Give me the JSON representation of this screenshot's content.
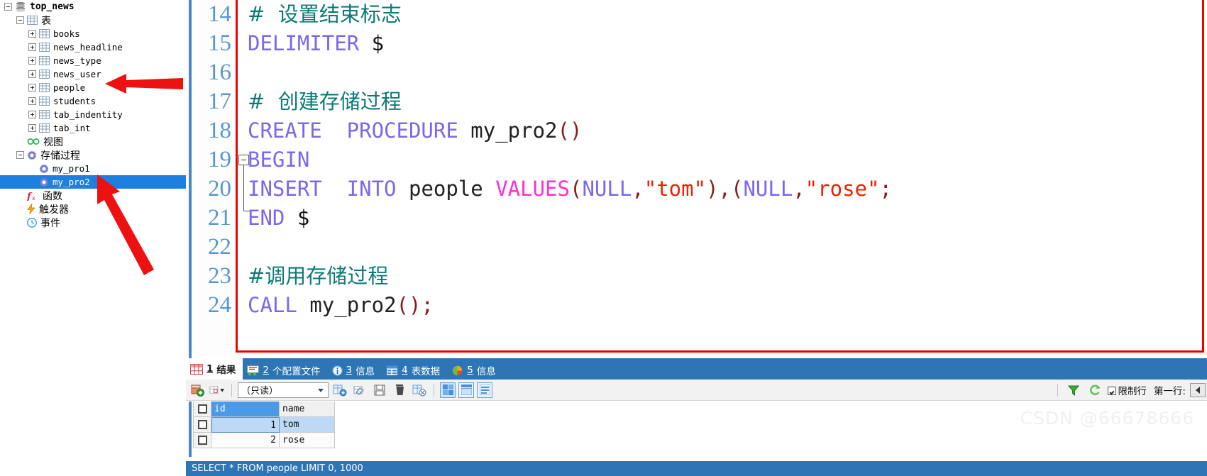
{
  "sidebar": {
    "nodes": [
      {
        "label": "top_news",
        "kind": "database",
        "indent": 0,
        "expander": "minus",
        "icon": "database-icon",
        "font": "mono-bold"
      },
      {
        "label": "表",
        "kind": "folder",
        "indent": 1,
        "expander": "minus",
        "icon": "table-group-icon",
        "font": "cjk"
      },
      {
        "label": "books",
        "kind": "table",
        "indent": 2,
        "expander": "plus",
        "icon": "table-icon",
        "font": "mono"
      },
      {
        "label": "news_headline",
        "kind": "table",
        "indent": 2,
        "expander": "plus",
        "icon": "table-icon",
        "font": "mono"
      },
      {
        "label": "news_type",
        "kind": "table",
        "indent": 2,
        "expander": "plus",
        "icon": "table-icon",
        "font": "mono"
      },
      {
        "label": "news_user",
        "kind": "table",
        "indent": 2,
        "expander": "plus",
        "icon": "table-icon",
        "font": "mono"
      },
      {
        "label": "people",
        "kind": "table",
        "indent": 2,
        "expander": "plus",
        "icon": "table-icon",
        "font": "mono"
      },
      {
        "label": "students",
        "kind": "table",
        "indent": 2,
        "expander": "plus",
        "icon": "table-icon",
        "font": "mono"
      },
      {
        "label": "tab_indentity",
        "kind": "table",
        "indent": 2,
        "expander": "plus",
        "icon": "table-icon",
        "font": "mono"
      },
      {
        "label": "tab_int",
        "kind": "table",
        "indent": 2,
        "expander": "plus",
        "icon": "table-icon",
        "font": "mono"
      },
      {
        "label": "视图",
        "kind": "folder",
        "indent": 1,
        "expander": "none",
        "icon": "view-glasses-icon",
        "font": "cjk"
      },
      {
        "label": "存储过程",
        "kind": "folder",
        "indent": 1,
        "expander": "minus",
        "icon": "gear-icon",
        "font": "cjk"
      },
      {
        "label": "my_pro1",
        "kind": "procedure",
        "indent": 2,
        "expander": "none",
        "icon": "gear-icon",
        "font": "mono"
      },
      {
        "label": "my_pro2",
        "kind": "procedure",
        "indent": 2,
        "expander": "none",
        "icon": "gear-icon",
        "font": "mono",
        "selected": true
      },
      {
        "label": "函数",
        "kind": "folder",
        "indent": 1,
        "expander": "none",
        "icon": "function-fx-icon",
        "font": "cjk"
      },
      {
        "label": "触发器",
        "kind": "folder",
        "indent": 1,
        "expander": "none",
        "icon": "lightning-icon",
        "font": "cjk"
      },
      {
        "label": "事件",
        "kind": "folder",
        "indent": 1,
        "expander": "none",
        "icon": "clock-icon",
        "font": "cjk"
      }
    ]
  },
  "editor": {
    "line_numbers": [
      "14",
      "15",
      "16",
      "17",
      "18",
      "19",
      "20",
      "21",
      "22",
      "23",
      "24"
    ],
    "lines": [
      {
        "no": "14",
        "tokens": [
          {
            "t": "#  设置结束标志",
            "c": "cmt",
            "cjk": true
          }
        ]
      },
      {
        "no": "15",
        "tokens": [
          {
            "t": "DELIMITER ",
            "c": "kw"
          },
          {
            "t": "$",
            "c": "dollar"
          }
        ]
      },
      {
        "no": "16",
        "tokens": []
      },
      {
        "no": "17",
        "tokens": [
          {
            "t": "#  创建存储过程",
            "c": "cmt",
            "cjk": true
          }
        ]
      },
      {
        "no": "18",
        "tokens": [
          {
            "t": "CREATE  PROCEDURE ",
            "c": "kw"
          },
          {
            "t": "my_pro2",
            "c": "pln"
          },
          {
            "t": "()",
            "c": "par"
          }
        ]
      },
      {
        "no": "19",
        "tokens": [
          {
            "t": "BEGIN",
            "c": "kw"
          }
        ]
      },
      {
        "no": "20",
        "tokens": [
          {
            "t": "INSERT  INTO ",
            "c": "kw"
          },
          {
            "t": "people ",
            "c": "pln"
          },
          {
            "t": "VALUES",
            "c": "mag"
          },
          {
            "t": "(",
            "c": "par"
          },
          {
            "t": "NULL",
            "c": "kw"
          },
          {
            "t": ",",
            "c": "par"
          },
          {
            "t": "\"tom\"",
            "c": "str"
          },
          {
            "t": "),(",
            "c": "par"
          },
          {
            "t": "NULL",
            "c": "kw"
          },
          {
            "t": ",",
            "c": "par"
          },
          {
            "t": "\"rose\"",
            "c": "str"
          },
          {
            "t": ";",
            "c": "par"
          }
        ]
      },
      {
        "no": "21",
        "tokens": [
          {
            "t": "END ",
            "c": "kw"
          },
          {
            "t": "$",
            "c": "dollar"
          }
        ]
      },
      {
        "no": "22",
        "tokens": []
      },
      {
        "no": "23",
        "tokens": [
          {
            "t": "#调用存储过程",
            "c": "cmt",
            "cjk": true
          }
        ]
      },
      {
        "no": "24",
        "tokens": [
          {
            "t": "CALL ",
            "c": "kw"
          },
          {
            "t": "my_pro2",
            "c": "pln"
          },
          {
            "t": "()",
            "c": "par"
          },
          {
            "t": ";",
            "c": "par"
          }
        ]
      }
    ],
    "colors": {
      "comment": "#0c7a75",
      "keyword": "#7b68ee",
      "values_keyword": "#ff2fd0",
      "string": "#ee2200",
      "paren": "#8b1a1a",
      "plain": "#222222",
      "line_number": "#5599cc",
      "highlight_border": "#ee0000"
    }
  },
  "result_panel": {
    "tabs": [
      {
        "num": "1",
        "label": "结果",
        "icon": "grid-result-icon",
        "active": true
      },
      {
        "num": "2",
        "label": "个配置文件",
        "icon": "profile-icon",
        "active": false
      },
      {
        "num": "3",
        "label": "信息",
        "icon": "info-icon",
        "active": false
      },
      {
        "num": "4",
        "label": "表数据",
        "icon": "table-data-icon",
        "active": false
      },
      {
        "num": "5",
        "label": "信息",
        "icon": "pie-chart-icon",
        "active": false
      }
    ],
    "toolbar": {
      "buttons": [
        {
          "name": "new-record-button",
          "icon": "new-row-icon"
        },
        {
          "name": "grid-mode-dropdown",
          "icon": "grid-dropdown-icon"
        },
        {
          "name": "apply-changes-button",
          "icon": "apply-icon"
        },
        {
          "name": "revert-button",
          "icon": "revert-icon"
        },
        {
          "name": "save-button",
          "icon": "floppy-disk-icon"
        },
        {
          "name": "delete-row-button",
          "icon": "trash-icon"
        },
        {
          "name": "export-button",
          "icon": "export-icon"
        },
        {
          "name": "grid-view-button",
          "icon": "grid-view-icon"
        },
        {
          "name": "form-view-button",
          "icon": "form-view-icon"
        },
        {
          "name": "field-view-button",
          "icon": "field-view-icon"
        }
      ],
      "readonly_value": "（只读）",
      "filter_icon": "funnel-filter-icon",
      "refresh_icon": "refresh-icon",
      "limit_rows_label": "限制行",
      "first_row_label": "第一行:",
      "limit_rows_checked": true
    },
    "grid": {
      "columns": [
        "id",
        "name"
      ],
      "rows": [
        {
          "id": "1",
          "name": "tom",
          "selected": true
        },
        {
          "id": "2",
          "name": "rose",
          "selected": false
        }
      ]
    },
    "status": "SELECT * FROM people LIMIT 0, 1000"
  },
  "watermark": "CSDN @66678666",
  "annotations": [
    {
      "name": "arrow-to-people-table",
      "note": "red arrow pointing at people table"
    },
    {
      "name": "arrow-to-my-pro2",
      "note": "red arrow pointing at my_pro2 procedure"
    }
  ]
}
